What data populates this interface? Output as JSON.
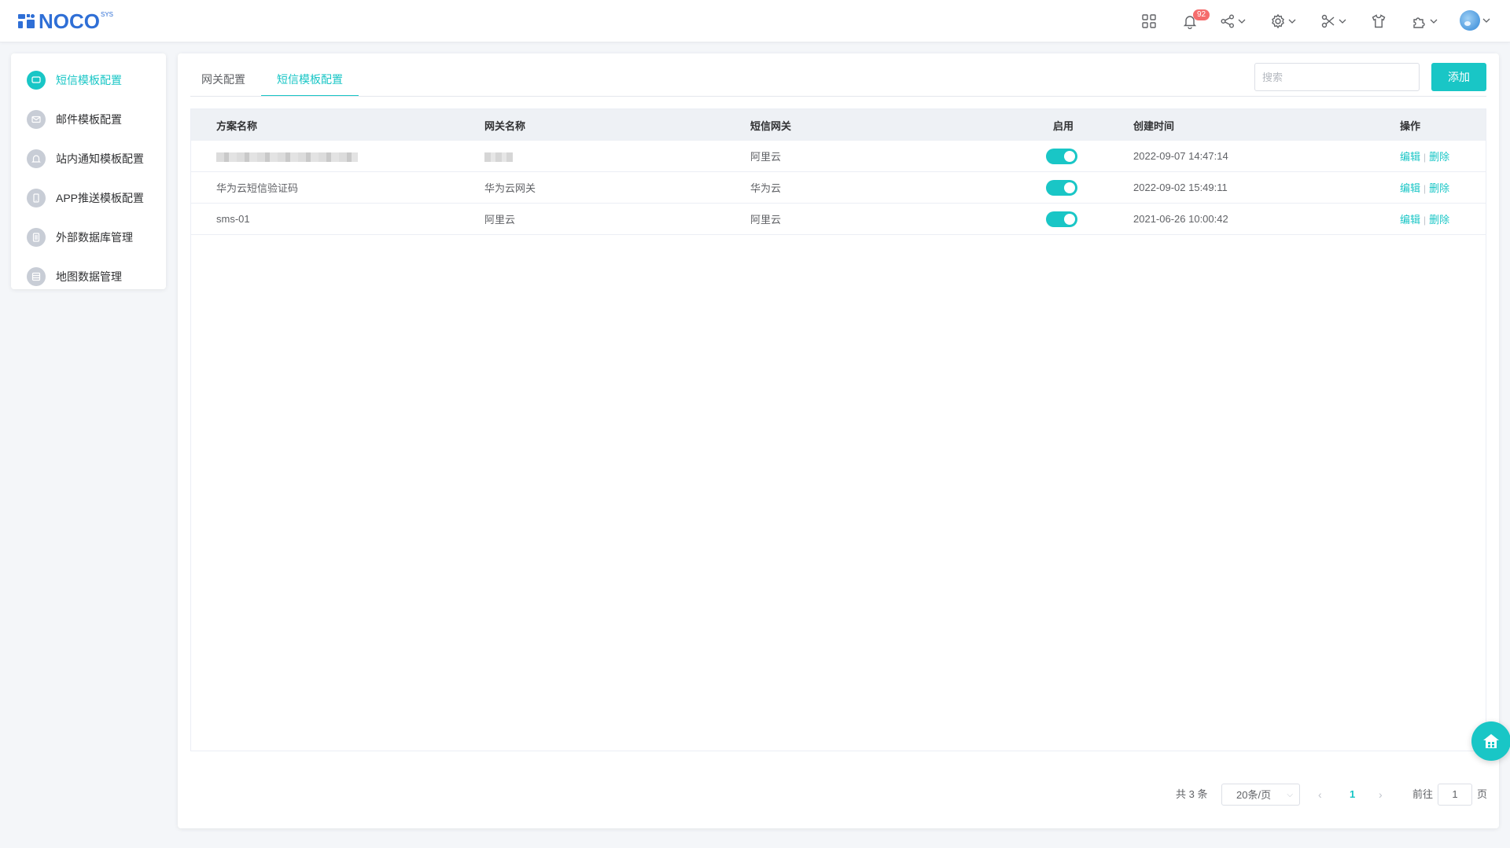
{
  "header": {
    "logo_text": "NOCO",
    "logo_sup": "SYS",
    "notification_count": "92",
    "icons": [
      "apps-icon",
      "bell-icon",
      "share-icon",
      "gear-icon",
      "tools-icon",
      "shirt-icon",
      "puzzle-icon",
      "avatar"
    ]
  },
  "sidebar": {
    "items": [
      {
        "label": "短信模板配置",
        "icon": "message-icon",
        "active": true
      },
      {
        "label": "邮件模板配置",
        "icon": "mail-icon",
        "active": false
      },
      {
        "label": "站内通知模板配置",
        "icon": "bell-icon",
        "active": false
      },
      {
        "label": "APP推送模板配置",
        "icon": "phone-icon",
        "active": false
      },
      {
        "label": "外部数据库管理",
        "icon": "database-icon",
        "active": false
      },
      {
        "label": "地图数据管理",
        "icon": "map-data-icon",
        "active": false
      }
    ]
  },
  "main": {
    "tabs": [
      {
        "label": "网关配置",
        "active": false
      },
      {
        "label": "短信模板配置",
        "active": true
      }
    ],
    "search_placeholder": "搜索",
    "add_label": "添加",
    "table": {
      "columns": [
        "方案名称",
        "网关名称",
        "短信网关",
        "启用",
        "创建时间",
        "操作"
      ],
      "rows": [
        {
          "name": "",
          "gateway_name": "",
          "sms_gateway": "阿里云",
          "enabled": true,
          "created": "2022-09-07 14:47:14",
          "redacted": true
        },
        {
          "name": "华为云短信验证码",
          "gateway_name": "华为云网关",
          "sms_gateway": "华为云",
          "enabled": true,
          "created": "2022-09-02 15:49:11",
          "redacted": false
        },
        {
          "name": "sms-01",
          "gateway_name": "阿里云",
          "sms_gateway": "阿里云",
          "enabled": true,
          "created": "2021-06-26 10:00:42",
          "redacted": false
        }
      ],
      "edit_label": "编辑",
      "delete_label": "删除"
    },
    "pagination": {
      "total": "共 3 条",
      "page_size": "20条/页",
      "current_page": "1",
      "goto_prefix": "前往",
      "goto_value": "1",
      "goto_suffix": "页"
    }
  },
  "colors": {
    "accent": "#19c6c6",
    "brand": "#2f6fd6",
    "badge": "#f56c6c"
  }
}
